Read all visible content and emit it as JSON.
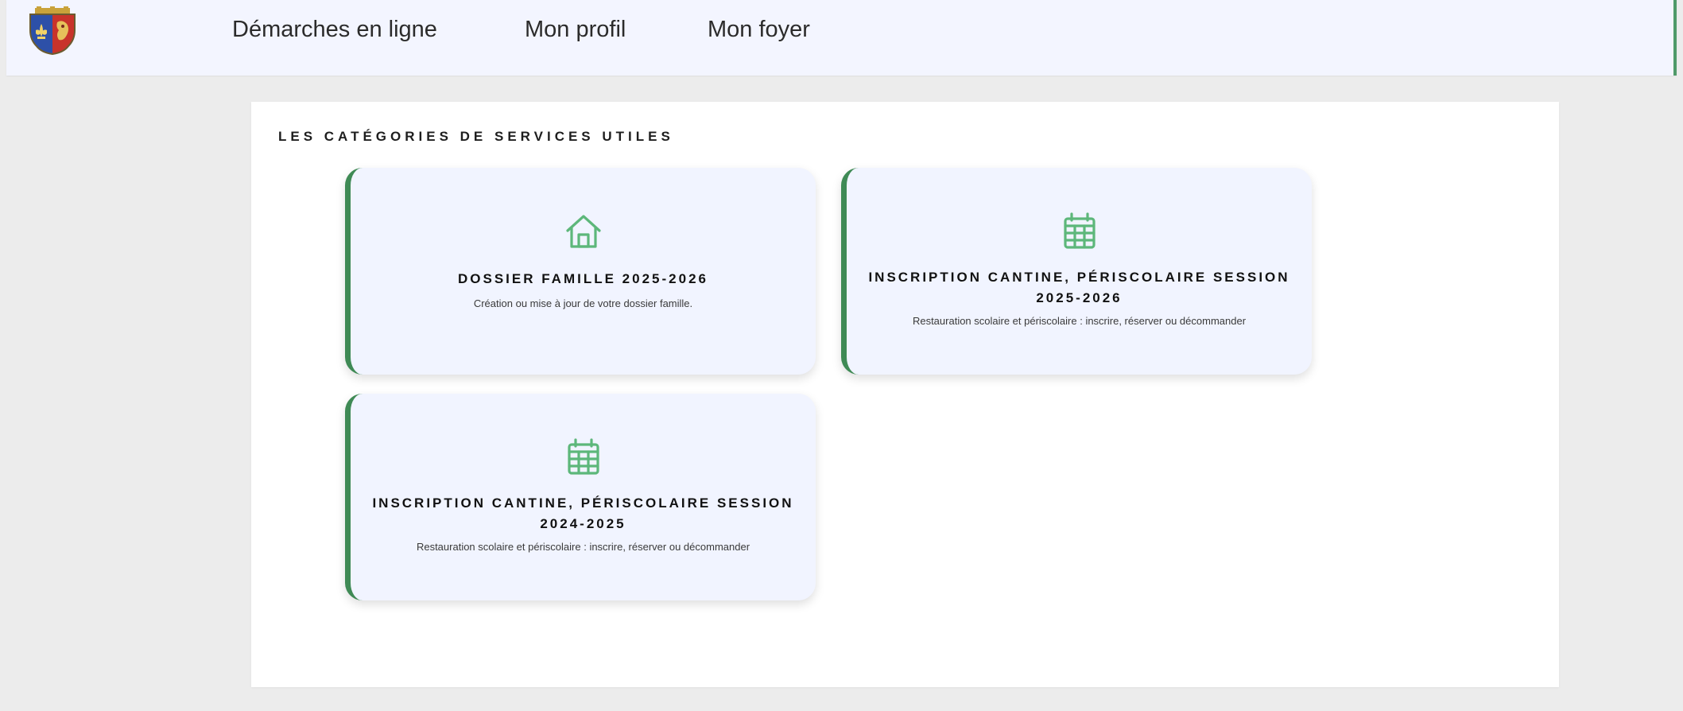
{
  "header": {
    "logo_icon": "coat-of-arms-icon",
    "nav": [
      {
        "label": "Démarches en ligne"
      },
      {
        "label": "Mon profil"
      },
      {
        "label": "Mon foyer"
      }
    ]
  },
  "main": {
    "section_title": "LES CATÉGORIES DE SERVICES UTILES",
    "cards": [
      {
        "icon": "home-icon",
        "title": "DOSSIER FAMILLE 2025-2026",
        "description": "Création ou mise à jour de votre dossier famille."
      },
      {
        "icon": "calendar-icon",
        "title": "INSCRIPTION CANTINE, PÉRISCOLAIRE SESSION 2025-2026",
        "description": "Restauration scolaire et périscolaire : inscrire, réserver ou décommander"
      },
      {
        "icon": "calendar-icon",
        "title": "INSCRIPTION CANTINE, PÉRISCOLAIRE SESSION 2024-2025",
        "description": "Restauration scolaire et périscolaire : inscrire, réserver ou décommander"
      }
    ]
  },
  "colors": {
    "accent_green": "#3f8a55",
    "icon_green": "#5db77a",
    "header_bg": "#f3f5ff",
    "card_bg": "#f1f4ff",
    "page_bg": "#ececec"
  }
}
